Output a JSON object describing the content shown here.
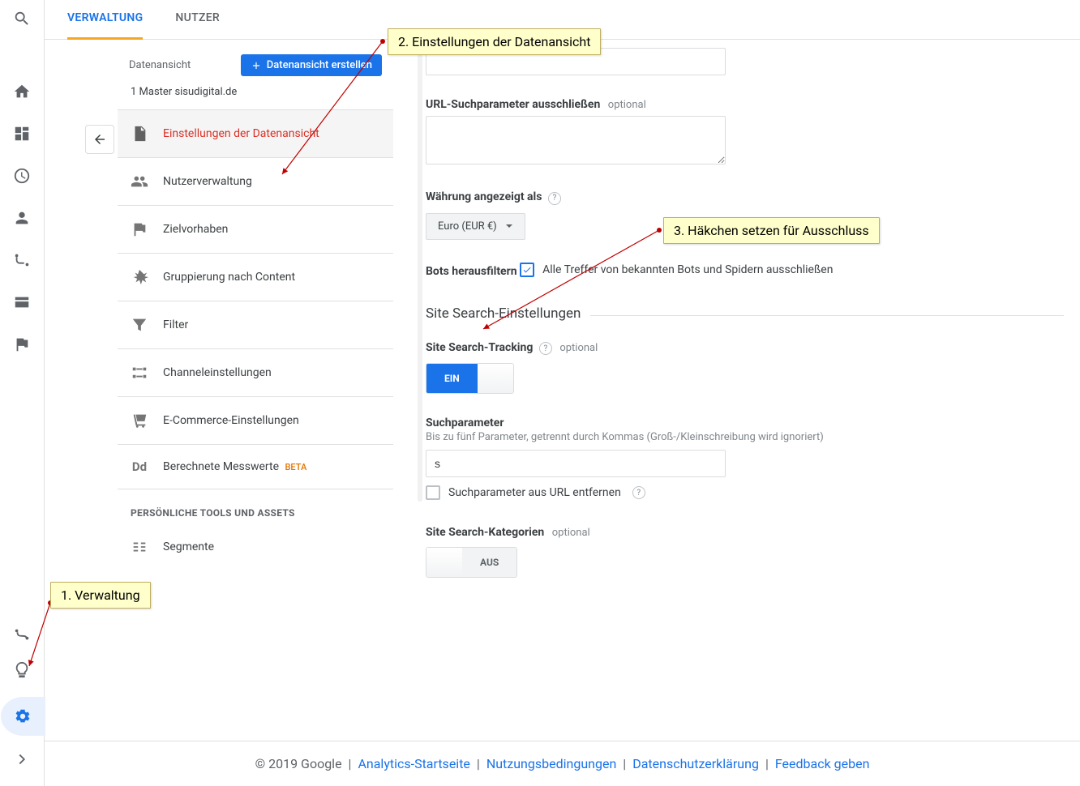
{
  "tabs": {
    "admin": "VERWALTUNG",
    "users": "NUTZER"
  },
  "sidebar_icons": [
    "search",
    "home",
    "dashboard",
    "clock",
    "person",
    "flow",
    "card",
    "flag",
    "path",
    "bulb",
    "gear",
    "chevron"
  ],
  "view": {
    "column_label": "Datenansicht",
    "create_button": "Datenansicht erstellen",
    "name": "1 Master sisudigital.de"
  },
  "menu": {
    "settings": "Einstellungen der Datenansicht",
    "user_mgmt": "Nutzerverwaltung",
    "goals": "Zielvorhaben",
    "content_group": "Gruppierung nach Content",
    "filters": "Filter",
    "channel": "Channeleinstellungen",
    "ecommerce": "E-Commerce-Einstellungen",
    "calc_metrics": "Berechnete Messwerte",
    "beta": "BETA",
    "section": "PERSÖNLICHE TOOLS UND ASSETS",
    "segments": "Segmente"
  },
  "form": {
    "url_exclude_label": "URL-Suchparameter ausschließen",
    "optional": "optional",
    "currency_label": "Währung angezeigt als",
    "currency_value": "Euro (EUR €)",
    "bots_header": "Bots herausfiltern",
    "bots_checkbox": "Alle Treffer von bekannten Bots und Spidern ausschließen",
    "site_search_section": "Site Search-Einstellungen",
    "site_search_tracking": "Site Search-Tracking",
    "toggle_on": "EIN",
    "toggle_off": "AUS",
    "search_param_label": "Suchparameter",
    "search_param_hint": "Bis zu fünf Parameter, getrennt durch Kommas (Groß-/Kleinschreibung wird ignoriert)",
    "search_param_value": "s",
    "strip_param": "Suchparameter aus URL entfernen",
    "site_search_cat": "Site Search-Kategorien"
  },
  "footer": {
    "copyright": "© 2019 Google",
    "links": [
      "Analytics-Startseite",
      "Nutzungsbedingungen",
      "Datenschutzerklärung",
      "Feedback geben"
    ]
  },
  "callouts": {
    "c1": "1. Verwaltung",
    "c2": "2. Einstellungen der Datenansicht",
    "c3": "3. Häkchen setzen für Ausschluss"
  }
}
